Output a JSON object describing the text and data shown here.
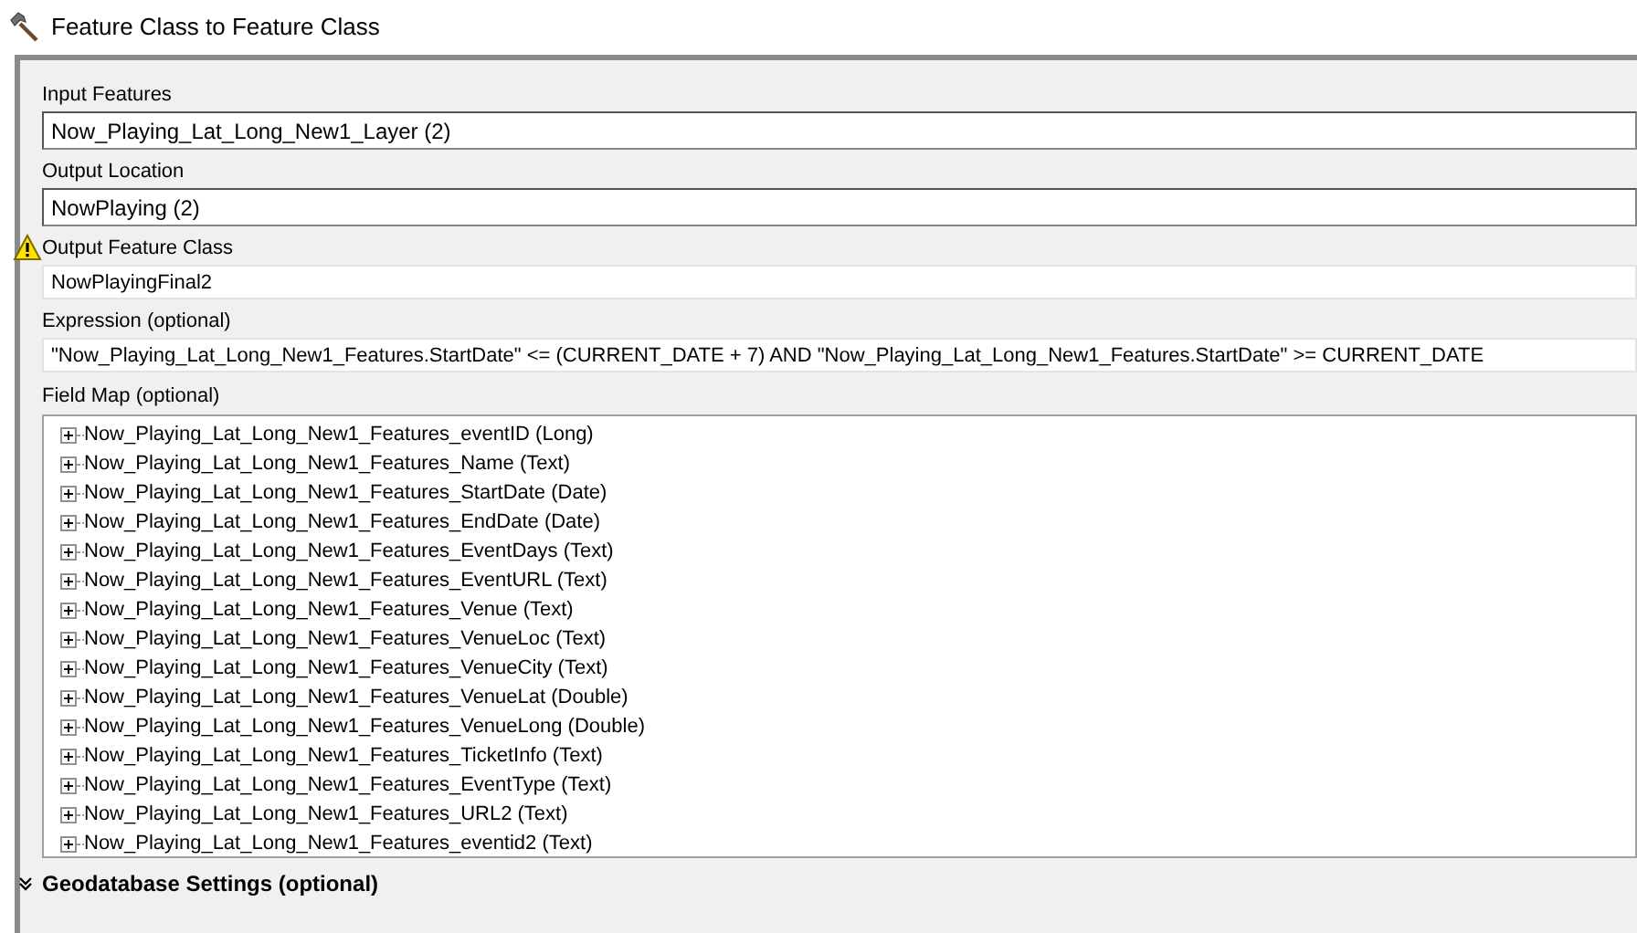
{
  "window": {
    "title": "Feature Class to Feature Class"
  },
  "parameters": [
    {
      "label": "Input Features",
      "value": "Now_Playing_Lat_Long_New1_Layer (2)",
      "kind": "combo",
      "warning": false
    },
    {
      "label": "Output Location",
      "value": "NowPlaying (2)",
      "kind": "combo",
      "warning": false
    },
    {
      "label": "Output Feature Class",
      "value": "NowPlayingFinal2",
      "kind": "text",
      "warning": true
    },
    {
      "label": "Expression (optional)",
      "value": "\"Now_Playing_Lat_Long_New1_Features.StartDate\" <= (CURRENT_DATE + 7) AND \"Now_Playing_Lat_Long_New1_Features.StartDate\" >= CURRENT_DATE",
      "kind": "text",
      "warning": false
    }
  ],
  "field_map": {
    "label": "Field Map (optional)",
    "items": [
      {
        "label": "Now_Playing_Lat_Long_New1_Features_eventID (Long)",
        "expanded": false
      },
      {
        "label": "Now_Playing_Lat_Long_New1_Features_Name (Text)",
        "expanded": false
      },
      {
        "label": "Now_Playing_Lat_Long_New1_Features_StartDate (Date)",
        "expanded": false
      },
      {
        "label": "Now_Playing_Lat_Long_New1_Features_EndDate (Date)",
        "expanded": false
      },
      {
        "label": "Now_Playing_Lat_Long_New1_Features_EventDays (Text)",
        "expanded": false
      },
      {
        "label": "Now_Playing_Lat_Long_New1_Features_EventURL (Text)",
        "expanded": false
      },
      {
        "label": "Now_Playing_Lat_Long_New1_Features_Venue (Text)",
        "expanded": false
      },
      {
        "label": "Now_Playing_Lat_Long_New1_Features_VenueLoc (Text)",
        "expanded": false
      },
      {
        "label": "Now_Playing_Lat_Long_New1_Features_VenueCity (Text)",
        "expanded": false
      },
      {
        "label": "Now_Playing_Lat_Long_New1_Features_VenueLat (Double)",
        "expanded": false
      },
      {
        "label": "Now_Playing_Lat_Long_New1_Features_VenueLong (Double)",
        "expanded": false
      },
      {
        "label": "Now_Playing_Lat_Long_New1_Features_TicketInfo (Text)",
        "expanded": false
      },
      {
        "label": "Now_Playing_Lat_Long_New1_Features_EventType (Text)",
        "expanded": false
      },
      {
        "label": "Now_Playing_Lat_Long_New1_Features_URL2 (Text)",
        "expanded": false
      },
      {
        "label": "Now_Playing_Lat_Long_New1_Features_eventid2 (Text)",
        "expanded": false
      }
    ]
  },
  "sections": [
    {
      "label": "Geodatabase Settings (optional)",
      "expanded": false
    }
  ]
}
